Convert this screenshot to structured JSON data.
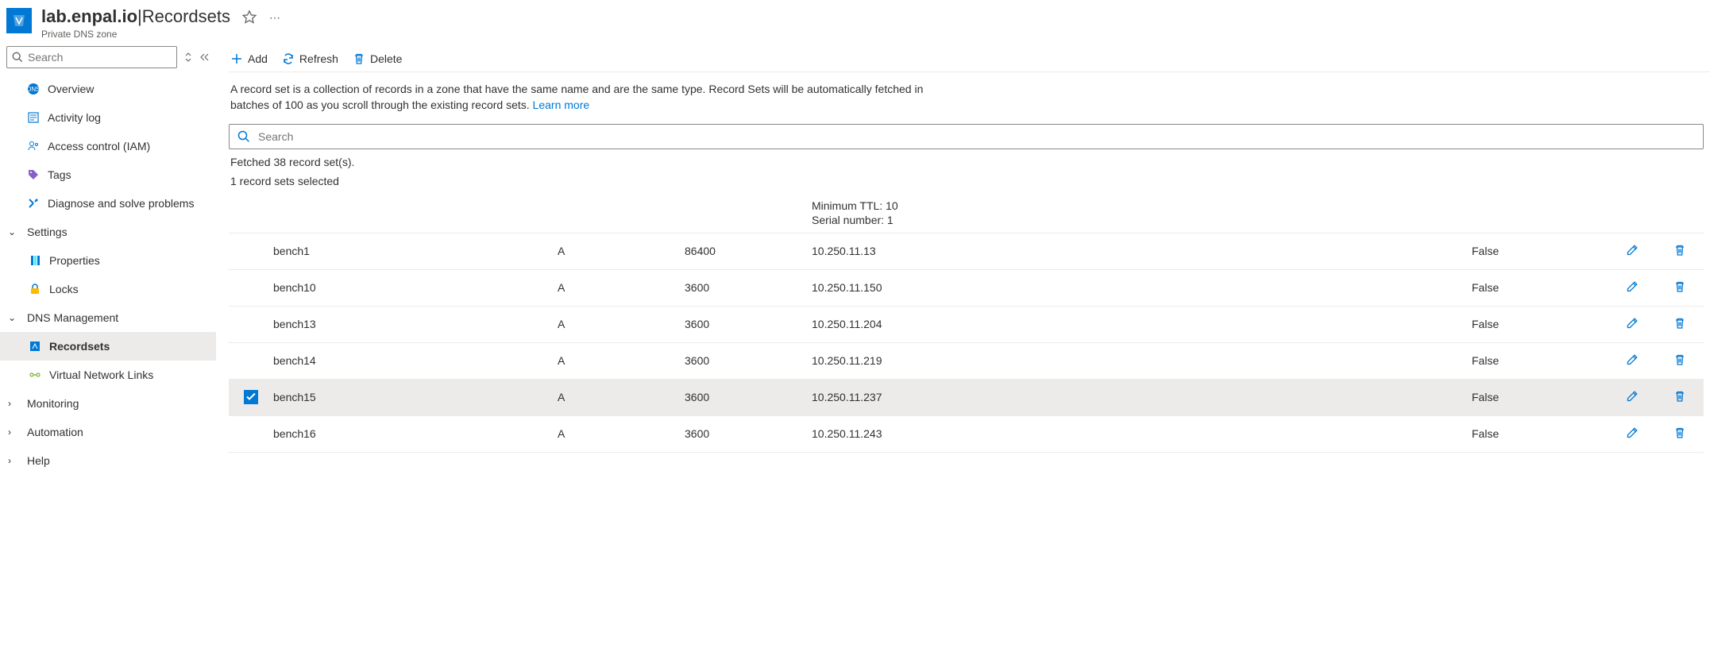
{
  "header": {
    "title_strong": "lab.enpal.io",
    "title_sep": " | ",
    "title_light": "Recordsets",
    "subtitle": "Private DNS zone"
  },
  "sidebar": {
    "search_placeholder": "Search",
    "items": [
      {
        "label": "Overview",
        "icon": "overview",
        "type": "item"
      },
      {
        "label": "Activity log",
        "icon": "activity",
        "type": "item"
      },
      {
        "label": "Access control (IAM)",
        "icon": "iam",
        "type": "item"
      },
      {
        "label": "Tags",
        "icon": "tags",
        "type": "item"
      },
      {
        "label": "Diagnose and solve problems",
        "icon": "diagnose",
        "type": "item"
      },
      {
        "label": "Settings",
        "type": "group",
        "expanded": true
      },
      {
        "label": "Properties",
        "icon": "properties",
        "type": "sub"
      },
      {
        "label": "Locks",
        "icon": "locks",
        "type": "sub"
      },
      {
        "label": "DNS Management",
        "type": "group",
        "expanded": true
      },
      {
        "label": "Recordsets",
        "icon": "recordsets",
        "type": "sub",
        "selected": true
      },
      {
        "label": "Virtual Network Links",
        "icon": "vnl",
        "type": "sub"
      },
      {
        "label": "Monitoring",
        "type": "group",
        "expanded": false
      },
      {
        "label": "Automation",
        "type": "group",
        "expanded": false
      },
      {
        "label": "Help",
        "type": "group",
        "expanded": false
      }
    ]
  },
  "toolbar": {
    "add": "Add",
    "refresh": "Refresh",
    "delete": "Delete"
  },
  "description": {
    "text": "A record set is a collection of records in a zone that have the same name and are the same type. Record Sets will be automatically fetched in batches of 100 as you scroll through the existing record sets. ",
    "link": "Learn more"
  },
  "search": {
    "placeholder": "Search"
  },
  "status": {
    "fetched": "Fetched 38 record set(s).",
    "selected": "1 record sets selected"
  },
  "soa": {
    "min_ttl": "Minimum TTL: 10",
    "serial": "Serial number: 1"
  },
  "rows": [
    {
      "name": "bench1",
      "type": "A",
      "ttl": "86400",
      "value": "10.250.11.13",
      "auto": "False",
      "selected": false
    },
    {
      "name": "bench10",
      "type": "A",
      "ttl": "3600",
      "value": "10.250.11.150",
      "auto": "False",
      "selected": false
    },
    {
      "name": "bench13",
      "type": "A",
      "ttl": "3600",
      "value": "10.250.11.204",
      "auto": "False",
      "selected": false
    },
    {
      "name": "bench14",
      "type": "A",
      "ttl": "3600",
      "value": "10.250.11.219",
      "auto": "False",
      "selected": false
    },
    {
      "name": "bench15",
      "type": "A",
      "ttl": "3600",
      "value": "10.250.11.237",
      "auto": "False",
      "selected": true
    },
    {
      "name": "bench16",
      "type": "A",
      "ttl": "3600",
      "value": "10.250.11.243",
      "auto": "False",
      "selected": false
    }
  ]
}
